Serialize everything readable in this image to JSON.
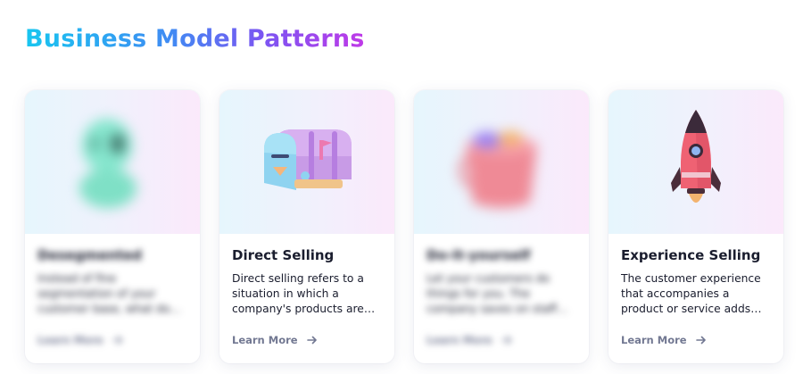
{
  "section": {
    "title": "Business Model Patterns"
  },
  "cards": [
    {
      "title": "Desegmented",
      "description": "Instead of fine segmentation of your customer base, what do…",
      "link_label": "Learn More",
      "image_icon": "alien-bust-icon",
      "blurred": true
    },
    {
      "title": "Direct Selling",
      "description": "Direct selling refers to a situation in which a company's products are…",
      "link_label": "Learn More",
      "image_icon": "mailbox-icon",
      "blurred": false
    },
    {
      "title": "Do-it-yourself",
      "description": "Let your customers do things for you. The company saves on staff…",
      "link_label": "Learn More",
      "image_icon": "paint-bucket-icon",
      "blurred": true
    },
    {
      "title": "Experience Selling",
      "description": "The customer experience that accompanies a product or service adds…",
      "link_label": "Learn More",
      "image_icon": "rocket-icon",
      "blurred": false
    }
  ],
  "colors": {
    "title_gradient": [
      "#18c6f0",
      "#3f8cf3",
      "#7b55f2",
      "#c03ae8"
    ],
    "card_image_gradient": [
      "#e6f6fd",
      "#f0f1fc",
      "#fbe9fb"
    ],
    "link_text": "#727892",
    "body_text": "#1a1d2e"
  }
}
